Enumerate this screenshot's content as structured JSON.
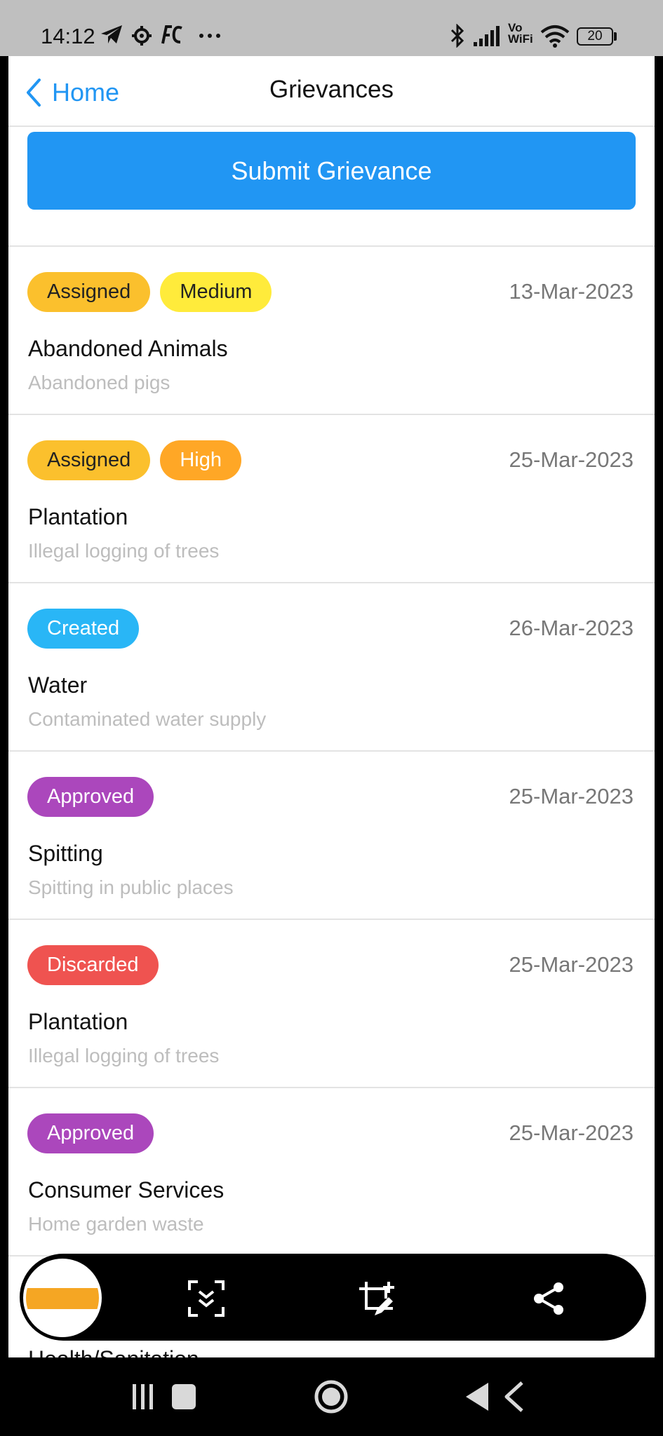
{
  "status_bar": {
    "time": "14:12",
    "network": "Vo WiFi",
    "battery": "20",
    "icons": [
      "telegram-icon",
      "gear-icon",
      "fc-icon",
      "more-dots-icon",
      "bluetooth-icon",
      "signal-icon",
      "wifi-icon",
      "battery-icon"
    ]
  },
  "header": {
    "back_label": "Home",
    "title": "Grievances"
  },
  "submit_button": {
    "label": "Submit Grievance"
  },
  "grievances": [
    {
      "badges": [
        {
          "label": "Assigned",
          "bg": "#fbc02d",
          "fg": "#222222"
        },
        {
          "label": "Medium",
          "bg": "#ffeb3b",
          "fg": "#222222"
        }
      ],
      "date": "13-Mar-2023",
      "title": "Abandoned Animals",
      "subtitle": "Abandoned pigs"
    },
    {
      "badges": [
        {
          "label": "Assigned",
          "bg": "#fbc02d",
          "fg": "#222222"
        },
        {
          "label": "High",
          "bg": "#ffa726",
          "fg": "#ffffff"
        }
      ],
      "date": "25-Mar-2023",
      "title": "Plantation",
      "subtitle": "Illegal logging of trees"
    },
    {
      "badges": [
        {
          "label": "Created",
          "bg": "#29b6f6",
          "fg": "#ffffff"
        }
      ],
      "date": "26-Mar-2023",
      "title": "Water",
      "subtitle": "Contaminated water supply"
    },
    {
      "badges": [
        {
          "label": "Approved",
          "bg": "#ab47bc",
          "fg": "#ffffff"
        }
      ],
      "date": "25-Mar-2023",
      "title": "Spitting",
      "subtitle": "Spitting in public places"
    },
    {
      "badges": [
        {
          "label": "Discarded",
          "bg": "#ef5350",
          "fg": "#ffffff"
        }
      ],
      "date": "25-Mar-2023",
      "title": "Plantation",
      "subtitle": "Illegal logging of trees"
    },
    {
      "badges": [
        {
          "label": "Approved",
          "bg": "#ab47bc",
          "fg": "#ffffff"
        }
      ],
      "date": "25-Mar-2023",
      "title": "Consumer Services",
      "subtitle": "Home garden waste"
    }
  ],
  "peek_item_title": "Health/Sanitation",
  "screenshot_toolbar": {
    "icons": [
      "scroll-capture-icon",
      "crop-edit-icon",
      "share-icon"
    ]
  },
  "nav_bar": {
    "icons": [
      "recents-icon",
      "home-icon",
      "back-icon"
    ]
  },
  "colors": {
    "accent": "#2196f3",
    "divider": "#e3e3e3",
    "date_text": "#777777",
    "subtitle_text": "#bdbdbd"
  }
}
